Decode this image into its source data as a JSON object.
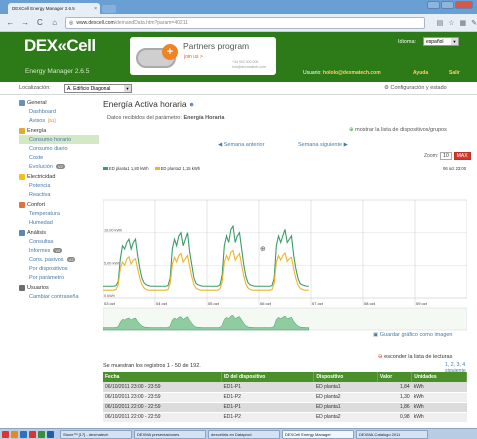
{
  "browser": {
    "tab_title": "DEXCell Energy Manager 2.6.5",
    "url_host": "www.dexcell.com",
    "url_path": "/demandData.htm?param=40211"
  },
  "header": {
    "logo_text": "DEX«Cell",
    "product_name": "Energy Manager 2.6.5",
    "partners_title": "Partners program",
    "partners_link": "join us >",
    "partners_phone": "+34 902 000 000",
    "partners_email": "info@dexmatech.com",
    "idioma_label": "Idioma:",
    "idioma_value": "español",
    "usuario_label": "Usuario:",
    "usuario_email": "hololo@dexmatech.com",
    "ayuda": "Ayuda",
    "salir": "Salir"
  },
  "subheader": {
    "localizacion_label": "Localización:",
    "localizacion_value": "A. Edificio Diagonal",
    "config_link": "Configuración y estado"
  },
  "sidebar": {
    "sections": [
      {
        "title": "General",
        "icon": "home-icon",
        "color": "#6d8fb5",
        "items": [
          {
            "label": "Dashboard"
          },
          {
            "label": "Avisos",
            "badge": "[51]"
          }
        ]
      },
      {
        "title": "Energía",
        "icon": "energy-icon",
        "color": "#e6a92f",
        "items": [
          {
            "label": "Consumo horario",
            "active": true
          },
          {
            "label": "Consumo diario"
          },
          {
            "label": "Coste"
          },
          {
            "label": "Evolución",
            "pill": "V2"
          }
        ]
      },
      {
        "title": "Electricidad",
        "icon": "lightning-icon",
        "color": "#f2c21b",
        "items": [
          {
            "label": "Potencia"
          },
          {
            "label": "Reactiva"
          }
        ]
      },
      {
        "title": "Confort",
        "icon": "thermometer-icon",
        "color": "#e0713a",
        "items": [
          {
            "label": "Temperatura"
          },
          {
            "label": "Humedad"
          }
        ]
      },
      {
        "title": "Análisis",
        "icon": "chart-icon",
        "color": "#5d87b3",
        "items": [
          {
            "label": "Consultas"
          },
          {
            "label": "Informes",
            "pill": "V2"
          },
          {
            "label": "Cons. pasivos",
            "pill": "V2"
          },
          {
            "label": "Por dispositivos"
          },
          {
            "label": "Por parámetro"
          }
        ]
      },
      {
        "title": "Usuarios",
        "icon": "users-icon",
        "color": "#6e6e6e",
        "items": [
          {
            "label": "Cambiar contraseña"
          }
        ]
      }
    ]
  },
  "main": {
    "title": "Energía Activa horaria",
    "subtitle_prefix": "Datos recibidos del parámetro:",
    "subtitle_param": "Energía Horaria",
    "show_list_link": "mostrar la lista de dispositivos/grupos",
    "prev_week": "Semana anterior",
    "next_week": "Semana siguiente",
    "zoom_label": "Zoom:",
    "zoom_10": "10",
    "zoom_max": "MAX",
    "legend_date": "06 oct 23:00",
    "save_chart": "Guardar gráfico como imagen",
    "hide_list": "esconder la lista de lecturas",
    "pager": "1, 2, 3, 4 siguiente",
    "records_text": "Se muestran los registros 1 - 50 de 192."
  },
  "chart_data": {
    "type": "line",
    "y_unit": "kWh",
    "ylim": [
      0,
      15
    ],
    "yticks": [
      "10,00 kWh",
      "5,00 kWh",
      "0 kWh"
    ],
    "x_ticks": [
      "03 oct",
      "04 oct",
      "05 oct",
      "06 oct",
      "07 oct",
      "08 oct",
      "09 oct"
    ],
    "series": [
      {
        "name": "ED planta1 1,80 kWh",
        "color": "#3c9c68",
        "values": [
          1.8,
          1.8,
          1.8,
          1.8,
          1.8,
          1.8,
          1.9,
          2.5,
          6,
          8,
          7.5,
          8.5,
          9,
          7.5,
          8.5,
          9,
          6.5,
          4.5,
          3,
          2.3,
          2,
          1.9,
          1.8,
          1.8,
          1.8,
          1.8,
          1.8,
          1.8,
          1.8,
          1.8,
          1.9,
          3,
          7.5,
          9,
          8,
          9.5,
          10,
          8,
          9,
          10,
          7,
          5,
          3,
          2.2,
          2,
          1.9,
          1.8,
          1.8,
          1.8,
          1.8,
          1.8,
          1.8,
          1.8,
          1.8,
          2,
          3.5,
          8,
          9.5,
          8.5,
          10.5,
          11,
          8.5,
          9.5,
          10,
          7.5,
          5,
          3.2,
          2.3,
          2,
          1.9,
          1.8,
          1.8,
          1.8,
          1.8,
          1.8,
          1.8,
          1.8,
          1.8,
          1.9,
          3,
          8,
          9.5,
          8.5,
          9.5,
          10.5,
          8.5,
          9,
          9.5,
          6.5,
          4.5,
          3,
          2.2,
          2,
          1.9,
          1.8,
          1.8
        ]
      },
      {
        "name": "ED planta2 1,15 kWh",
        "color": "#f0b429",
        "values": [
          1.2,
          1.2,
          1.2,
          1.2,
          1.2,
          1.2,
          1.3,
          2,
          4.5,
          5.5,
          5,
          6,
          6.3,
          5.2,
          5.8,
          6,
          4.5,
          3,
          2,
          1.5,
          1.3,
          1.2,
          1.2,
          1.2,
          1.2,
          1.2,
          1.2,
          1.2,
          1.2,
          1.2,
          1.3,
          2.2,
          5.2,
          6.2,
          5.5,
          6.5,
          6.8,
          5.5,
          6,
          6.5,
          4.8,
          3.2,
          2,
          1.5,
          1.3,
          1.2,
          1.2,
          1.2,
          1.2,
          1.2,
          1.2,
          1.2,
          1.2,
          1.2,
          1.4,
          2.5,
          5.5,
          6.5,
          5.8,
          7,
          7.3,
          5.8,
          6.3,
          6.8,
          5,
          3.3,
          2.1,
          1.5,
          1.3,
          1.2,
          1.2,
          1.2,
          1.2,
          1.2,
          1.2,
          1.2,
          1.2,
          1.2,
          1.3,
          2.2,
          5.5,
          6.5,
          5.8,
          6.5,
          6.9,
          5.6,
          6,
          6.2,
          4.5,
          3,
          2,
          1.5,
          1.3,
          1.2,
          1.2,
          1.2
        ]
      }
    ]
  },
  "table": {
    "headers": [
      "Fecha",
      "ID del dispositivo",
      "Dispositivo",
      "Valor",
      "Unidades"
    ],
    "rows": [
      [
        "06/10/2011 23:00 - 23:59",
        "ED1-P1",
        "ED planta1",
        "1,84",
        "kWh"
      ],
      [
        "06/10/2011 23:00 - 23:59",
        "ED1-P2",
        "ED planta2",
        "1,30",
        "kWh"
      ],
      [
        "06/10/2011 22:00 - 22:59",
        "ED1-P1",
        "ED planta1",
        "1,86",
        "kWh"
      ],
      [
        "06/10/2011 22:00 - 22:59",
        "ED1-P2",
        "ED planta2",
        "0,98",
        "kWh"
      ]
    ]
  },
  "taskbar": {
    "tasks": [
      "Stone™ [17] - dexmatech",
      "DEXMA presentaciones",
      "dexcellxls en Dataprod",
      "DEXCell Energy Manager",
      "DEXMA-Catalogo 2011"
    ]
  }
}
